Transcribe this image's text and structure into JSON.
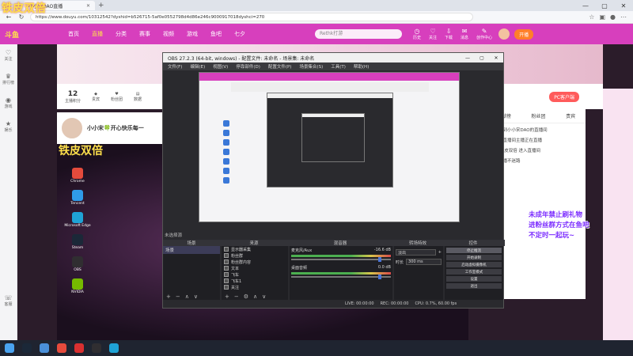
{
  "browser": {
    "tab_title": "小小宋DAO直播",
    "new_tab": "+",
    "url": "https://www.douyu.com/10312542?dyshid=b526715-5af0e0552798d4d86e246c9000917018dyshci=270",
    "window_controls": [
      "—",
      "▢",
      "✕"
    ]
  },
  "watermark": "铁皮双倍",
  "site": {
    "nav": [
      "首页",
      "直播",
      "分类",
      "赛事",
      "视频",
      "游戏",
      "鱼吧",
      "七夕"
    ],
    "active_nav_index": 1,
    "search_placeholder": "Rethk打游",
    "header_icons": [
      "历史",
      "关注",
      "下载",
      "消息",
      "创作中心"
    ],
    "start_live": "开播"
  },
  "sidebar": {
    "items": [
      "关注",
      "排行榜",
      "游戏",
      "娱乐",
      "客服"
    ]
  },
  "room": {
    "rank_value": "12",
    "rank_label": "主播积分",
    "items": [
      "主播积分",
      "贵宾",
      "粉丝团",
      "数据"
    ],
    "pc_client": "PC客户端",
    "streamer_name": "小小宋🍀开心快乐每一"
  },
  "desktop_icons": [
    "Chrome",
    "Tencent",
    "Microsoft Edge",
    "Steam",
    "OBS",
    "NVIDIA"
  ],
  "chat": {
    "tabs": [
      "贡献榜",
      "粉丝团",
      "贵宾"
    ],
    "messages": [
      "欢迎来到小小宋DAO的直播间",
      "我们的直播间主播正在直播",
      "欢迎 铁皮双倍 进入直播间",
      "关注主播不迷路"
    ]
  },
  "overlay_lines": [
    "未成年禁止刷礼物",
    "进粉丝群方式在鱼吧",
    "不定时一起玩~"
  ],
  "obs": {
    "title": "OBS 27.2.3 (64-bit, windows) - 配置文件: 未命名 - 场景集: 未命名",
    "menu": [
      "文件(F)",
      "编辑(E)",
      "视图(V)",
      "停靠部件(D)",
      "配置文件(P)",
      "场景集合(S)",
      "工具(T)",
      "帮助(H)"
    ],
    "scene_none": "未选择源",
    "docks": [
      "场景",
      "来源",
      "混音器",
      "转场特效",
      "控件"
    ],
    "scene_selected": "场景",
    "sources": [
      "显示器采集",
      "粉丝群",
      "粉丝群内容",
      "文本",
      "飞车",
      "飞车1",
      "关注"
    ],
    "mixer": [
      {
        "name": "麦克风/Aux",
        "db": "-16.6 dB"
      },
      {
        "name": "桌面音频",
        "db": "0.0 dB"
      }
    ],
    "transition": "淡出",
    "duration_label": "时长",
    "duration": "300 ms",
    "controls": [
      "停止推流",
      "开始录制",
      "启动虚拟摄像机",
      "工作室模式",
      "设置",
      "退出"
    ],
    "status": [
      "LIVE: 00:00:00",
      "REC: 00:00:00",
      "CPU: 0.7%, 60.00 fps"
    ]
  }
}
